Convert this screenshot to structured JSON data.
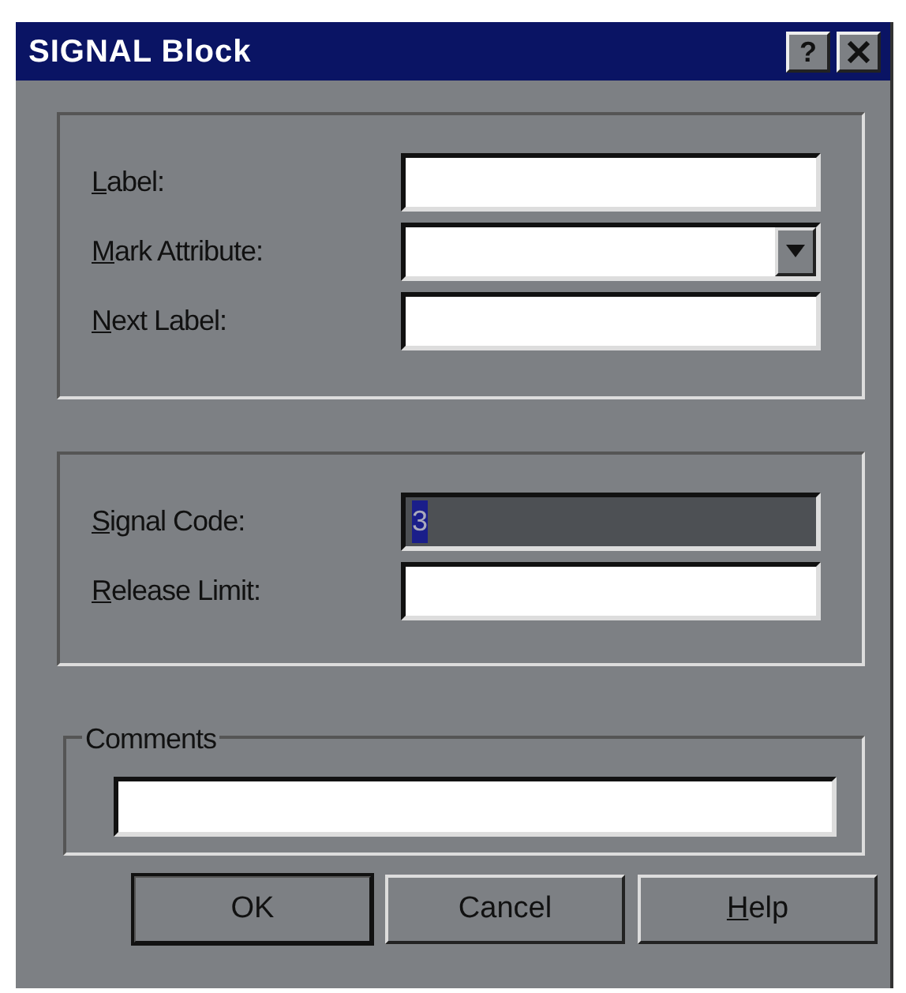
{
  "window": {
    "title": "SIGNAL Block",
    "help_button": "?"
  },
  "groups": [
    {
      "fields": [
        {
          "label": "Label:",
          "first_letter_underlined": true,
          "kind": "text",
          "disabled": false
        },
        {
          "label": "Mark Attribute:",
          "first_letter_underlined": true,
          "kind": "dropdown",
          "disabled": false
        },
        {
          "label": "Next Label:",
          "first_letter_underlined": true,
          "kind": "text",
          "disabled": false
        }
      ]
    },
    {
      "fields": [
        {
          "label": "Signal Code:",
          "first_letter_underlined": true,
          "kind": "text",
          "disabled": true,
          "value": "3",
          "value_selected": true
        },
        {
          "label": "Release Limit:",
          "first_letter_underlined": true,
          "kind": "text",
          "disabled": false
        }
      ]
    }
  ],
  "comments": {
    "legend": "Comments"
  },
  "buttons": [
    {
      "label": "OK",
      "first_letter_underlined": false,
      "default": true
    },
    {
      "label": "Cancel",
      "first_letter_underlined": false,
      "default": false
    },
    {
      "label": "Help",
      "first_letter_underlined": true,
      "default": false
    }
  ]
}
